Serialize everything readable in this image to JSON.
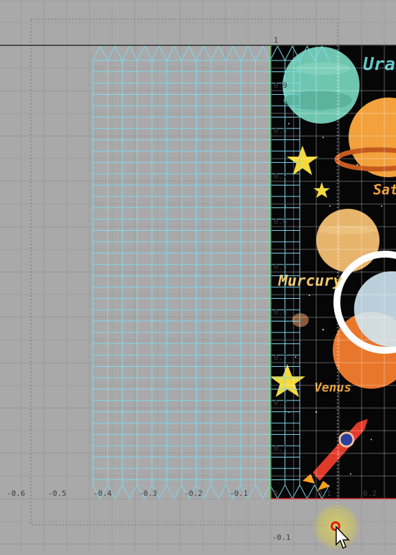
{
  "editor": {
    "x_axis_labels": [
      "-0.6",
      "-0.5",
      "-0.4",
      "-0.3",
      "-0.2",
      "-0.1",
      "0",
      "0.1",
      "0.2"
    ],
    "y_axis_labels": [
      "1",
      "0.9",
      "0.8",
      "0.7",
      "0.6",
      "0.5",
      "0.4",
      "0.3",
      "0.2",
      "0.1",
      "-0.1"
    ]
  },
  "texture": {
    "labels": {
      "uranus": "Ura",
      "saturn": "Sat",
      "mercury": "Murcury",
      "venus": "Venus"
    }
  },
  "colors": {
    "background": "#a9a9a9",
    "grid": "#9a9a9a",
    "uv_mesh": "#7fd8f0",
    "space": "#050505",
    "axis_red": "#e03030",
    "cursor_ring": "#e01818"
  },
  "icons": {
    "cursor": "mouse-pointer-icon",
    "rocket": "rocket-icon",
    "star": "star-icon"
  }
}
